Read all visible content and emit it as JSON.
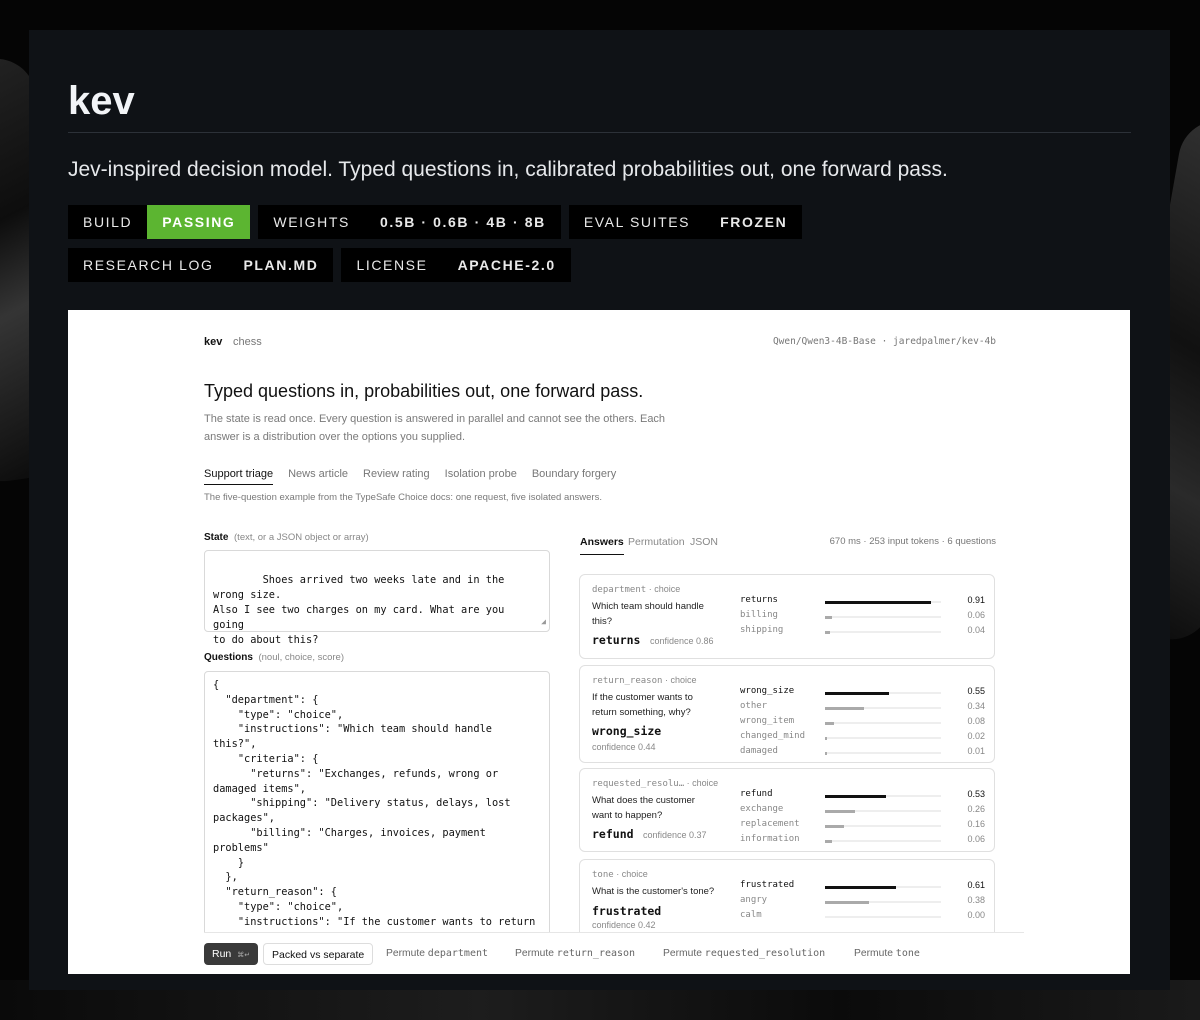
{
  "repo": {
    "title": "kev",
    "tagline": "Jev-inspired decision model. Typed questions in, calibrated probabilities out, one forward pass.",
    "badges": [
      {
        "label": "BUILD",
        "value": "PASSING",
        "value_color": "#5cb531"
      },
      {
        "label": "WEIGHTS",
        "value": "0.5B · 0.6B · 4B · 8B"
      },
      {
        "label": "EVAL SUITES",
        "value": "FROZEN"
      },
      {
        "label": "RESEARCH LOG",
        "value": "PLAN.MD"
      },
      {
        "label": "LICENSE",
        "value": "APACHE-2.0"
      }
    ]
  },
  "app": {
    "brand": "kev",
    "brand_sub": "chess",
    "model_path": "Qwen/Qwen3-4B-Base · jaredpalmer/kev-4b",
    "hero_title": "Typed questions in, probabilities out, one forward pass.",
    "hero_desc": "The state is read once. Every question is answered in parallel and cannot see the others. Each answer is a distribution over the options you supplied.",
    "tabs": [
      "Support triage",
      "News article",
      "Review rating",
      "Isolation probe",
      "Boundary forgery"
    ],
    "active_tab": 0,
    "tab_desc": "The five-question example from the TypeSafe Choice docs: one request, five isolated answers.",
    "state_label": "State",
    "state_hint": "(text, or a JSON object or array)",
    "state_value": "Shoes arrived two weeks late and in the wrong size.\nAlso I see two charges on my card. What are you going\nto do about this?",
    "questions_label": "Questions",
    "questions_hint": "(noul, choice, score)",
    "questions_value": "{\n  \"department\": {\n    \"type\": \"choice\",\n    \"instructions\": \"Which team should handle this?\",\n    \"criteria\": {\n      \"returns\": \"Exchanges, refunds, wrong or\ndamaged items\",\n      \"shipping\": \"Delivery status, delays, lost\npackages\",\n      \"billing\": \"Charges, invoices, payment\nproblems\"\n    }\n  },\n  \"return_reason\": {\n    \"type\": \"choice\",\n    \"instructions\": \"If the customer wants to return\nsomething, why?\",",
    "answers_tabs": [
      "Answers",
      "Permutation",
      "JSON"
    ],
    "answers_meta": "670 ms · 253 input tokens · 6 questions",
    "cards": [
      {
        "key": "department",
        "kind": "· choice",
        "question": "Which team should handle this?",
        "pick": "returns",
        "confidence": "confidence 0.86",
        "options": [
          {
            "name": "returns",
            "value": "0.91",
            "p": 0.91
          },
          {
            "name": "billing",
            "value": "0.06",
            "p": 0.06
          },
          {
            "name": "shipping",
            "value": "0.04",
            "p": 0.04
          }
        ]
      },
      {
        "key": "return_reason",
        "kind": "· choice",
        "question": "If the customer wants to return something, why?",
        "pick": "wrong_size",
        "confidence": "confidence 0.44",
        "options": [
          {
            "name": "wrong_size",
            "value": "0.55",
            "p": 0.55
          },
          {
            "name": "other",
            "value": "0.34",
            "p": 0.34
          },
          {
            "name": "wrong_item",
            "value": "0.08",
            "p": 0.08
          },
          {
            "name": "changed_mind",
            "value": "0.02",
            "p": 0.02
          },
          {
            "name": "damaged",
            "value": "0.01",
            "p": 0.01
          }
        ]
      },
      {
        "key": "requested_resolu…",
        "kind": "· choice",
        "question": "What does the customer want to happen?",
        "pick": "refund",
        "confidence": "confidence 0.37",
        "options": [
          {
            "name": "refund",
            "value": "0.53",
            "p": 0.53
          },
          {
            "name": "exchange",
            "value": "0.26",
            "p": 0.26
          },
          {
            "name": "replacement",
            "value": "0.16",
            "p": 0.16
          },
          {
            "name": "information",
            "value": "0.06",
            "p": 0.06
          }
        ]
      },
      {
        "key": "tone",
        "kind": "· choice",
        "question": "What is the customer's tone?",
        "pick": "frustrated",
        "confidence": "confidence 0.42",
        "options": [
          {
            "name": "frustrated",
            "value": "0.61",
            "p": 0.61
          },
          {
            "name": "angry",
            "value": "0.38",
            "p": 0.38
          },
          {
            "name": "calm",
            "value": "0.00",
            "p": 0.0
          }
        ]
      }
    ],
    "bottom": {
      "run": "Run",
      "run_kbd": "⌘↵",
      "packed": "Packed vs separate",
      "permute_prefix": "Permute",
      "permute_targets": [
        "department",
        "return_reason",
        "requested_resolution",
        "tone"
      ]
    }
  }
}
